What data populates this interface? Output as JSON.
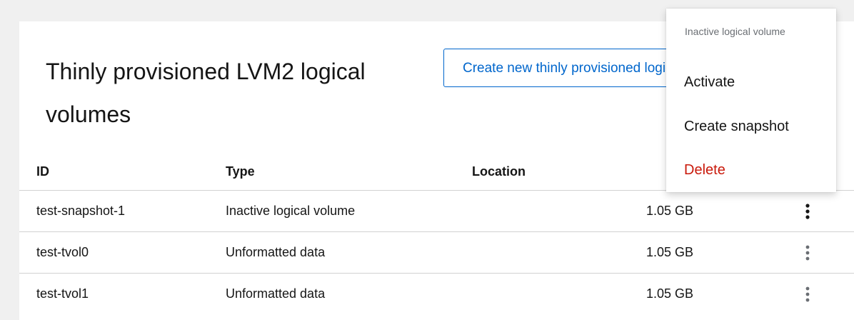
{
  "top_strip": {
    "text": "file:///tmp/fake-path-to-screenshot-caption-hidden.png"
  },
  "card": {
    "title": "Thinly provisioned LVM2 logical volumes",
    "create_button_label": "Create new thinly provisioned logical volume"
  },
  "table": {
    "columns": [
      "ID",
      "Type",
      "Location"
    ],
    "rows": [
      {
        "id": "test-snapshot-1",
        "type": "Inactive logical volume",
        "location": "",
        "size": "1.05 GB"
      },
      {
        "id": "test-tvol0",
        "type": "Unformatted data",
        "location": "",
        "size": "1.05 GB"
      },
      {
        "id": "test-tvol1",
        "type": "Unformatted data",
        "location": "",
        "size": "1.05 GB"
      }
    ]
  },
  "menu": {
    "header": "Inactive logical volume",
    "items": [
      {
        "label": "Activate"
      },
      {
        "label": "Create snapshot"
      },
      {
        "label": "Delete"
      }
    ]
  },
  "icons": {
    "kebab": "kebab-vertical-icon"
  },
  "colors": {
    "accent": "#0066cc",
    "danger": "#c9190b",
    "muted": "#6a6e73",
    "active_kebab": "#151515",
    "inactive_kebab": "#6a6e73"
  }
}
